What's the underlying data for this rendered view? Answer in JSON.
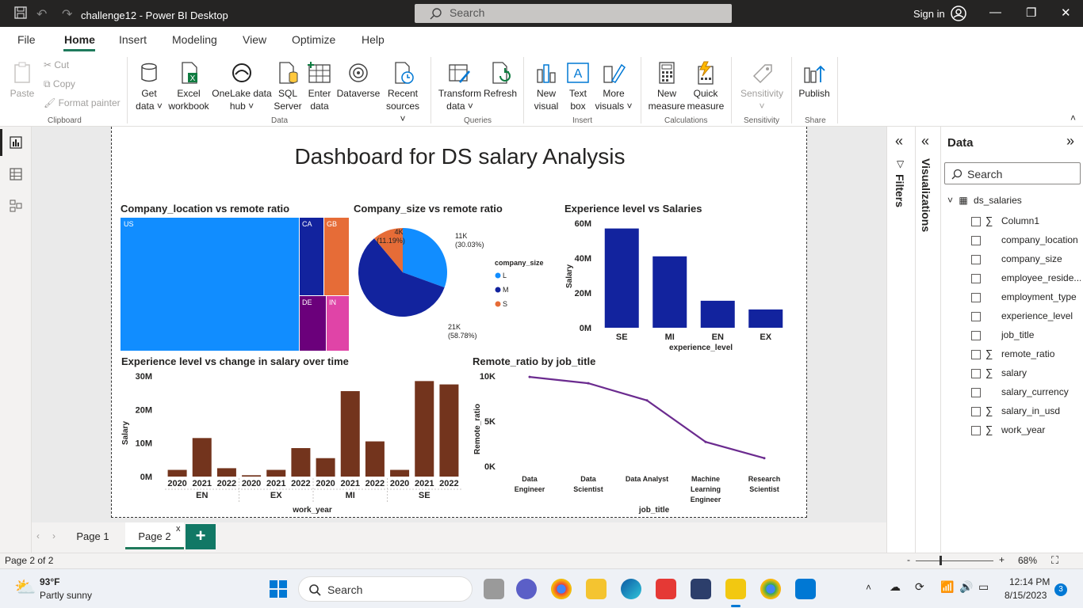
{
  "window": {
    "title": "challenge12 - Power BI Desktop",
    "search_placeholder": "Search",
    "signin": "Sign in"
  },
  "menu": {
    "file": "File",
    "home": "Home",
    "insert": "Insert",
    "modeling": "Modeling",
    "view": "View",
    "optimize": "Optimize",
    "help": "Help"
  },
  "ribbon": {
    "clipboard": {
      "paste": "Paste",
      "cut": "Cut",
      "copy": "Copy",
      "format_painter": "Format painter",
      "label": "Clipboard"
    },
    "data": {
      "get_data_1": "Get",
      "get_data_2": "data",
      "excel_1": "Excel",
      "excel_2": "workbook",
      "onelake_1": "OneLake data",
      "onelake_2": "hub",
      "sql_1": "SQL",
      "sql_2": "Server",
      "enter_1": "Enter",
      "enter_2": "data",
      "dataverse": "Dataverse",
      "recent_1": "Recent",
      "recent_2": "sources",
      "label": "Data"
    },
    "queries": {
      "transform_1": "Transform",
      "transform_2": "data",
      "refresh": "Refresh",
      "label": "Queries"
    },
    "insert": {
      "newvisual_1": "New",
      "newvisual_2": "visual",
      "textbox_1": "Text",
      "textbox_2": "box",
      "morevisuals_1": "More",
      "morevisuals_2": "visuals",
      "label": "Insert"
    },
    "calculations": {
      "newmeasure_1": "New",
      "newmeasure_2": "measure",
      "quick_1": "Quick",
      "quick_2": "measure",
      "label": "Calculations"
    },
    "sensitivity": {
      "btn": "Sensitivity",
      "label": "Sensitivity"
    },
    "share": {
      "publish": "Publish",
      "label": "Share"
    }
  },
  "report": {
    "title": "Dashboard for DS salary Analysis",
    "treemap_title": "Company_location vs remote ratio",
    "pie_title": "Company_size vs remote ratio",
    "bar1_title": "Experience level vs Salaries",
    "bar2_title": "Experience level vs change in salary over time",
    "line_title": "Remote_ratio by job_title"
  },
  "chart_data": [
    {
      "type": "treemap",
      "title": "Company_location vs remote ratio",
      "categories": [
        "US",
        "CA",
        "GB",
        "DE",
        "IN"
      ],
      "colors": [
        "#118dff",
        "#12239e",
        "#e66c37",
        "#6b007b",
        "#e044a7"
      ]
    },
    {
      "type": "pie",
      "title": "Company_size vs remote ratio",
      "legend_title": "company_size",
      "legend_position": "right",
      "slices": [
        {
          "name": "L",
          "value": 11000,
          "label": "11K",
          "pct": "(30.03%)",
          "color": "#118dff"
        },
        {
          "name": "M",
          "value": 21000,
          "label": "21K",
          "pct": "(58.78%)",
          "color": "#12239e"
        },
        {
          "name": "S",
          "value": 4000,
          "label": "4K",
          "pct": "(11.19%)",
          "color": "#e66c37"
        }
      ]
    },
    {
      "type": "bar",
      "title": "Experience level vs Salaries",
      "categories": [
        "SE",
        "MI",
        "EN",
        "EX"
      ],
      "values": [
        57000000,
        41000000,
        15500000,
        10500000
      ],
      "xlabel": "experience_level",
      "ylabel": "Salary",
      "ylim": [
        0,
        60000000
      ],
      "yticks": [
        "0M",
        "20M",
        "40M",
        "60M"
      ],
      "color": "#12239e"
    },
    {
      "type": "bar",
      "title": "Experience level vs change in salary over time",
      "groups": [
        "EN",
        "EX",
        "MI",
        "SE"
      ],
      "years": [
        "2020",
        "2021",
        "2022"
      ],
      "values": [
        2000000,
        11500000,
        2500000,
        400000,
        2000000,
        8500000,
        5500000,
        25500000,
        10500000,
        2000000,
        28500000,
        27500000
      ],
      "xlabel": "work_year",
      "ylabel": "Salary",
      "ylim": [
        0,
        30000000
      ],
      "yticks": [
        "0M",
        "10M",
        "20M",
        "30M"
      ],
      "color": "#73341d"
    },
    {
      "type": "line",
      "title": "Remote_ratio by job_title",
      "categories": [
        "Data Engineer",
        "Data Scientist",
        "Data Analyst",
        "Machine Learning Engineer",
        "Research Scientist"
      ],
      "cat_lines": [
        [
          "Data",
          "Engineer"
        ],
        [
          "Data",
          "Scientist"
        ],
        [
          "Data Analyst"
        ],
        [
          "Machine",
          "Learning",
          "Engineer"
        ],
        [
          "Research",
          "Scientist"
        ]
      ],
      "values": [
        9900,
        9200,
        7300,
        2700,
        900
      ],
      "xlabel": "job_title",
      "ylabel": "Remote_ratio",
      "ylim": [
        0,
        10000
      ],
      "yticks": [
        "0K",
        "5K",
        "10K"
      ],
      "color": "#6b2b8f"
    }
  ],
  "panes": {
    "filters": "Filters",
    "visualizations": "Visualizations",
    "data": "Data",
    "search": "Search",
    "table": "ds_salaries"
  },
  "fields": [
    {
      "name": "Column1",
      "sigma": true
    },
    {
      "name": "company_location",
      "sigma": false
    },
    {
      "name": "company_size",
      "sigma": false
    },
    {
      "name": "employee_reside...",
      "sigma": false
    },
    {
      "name": "employment_type",
      "sigma": false
    },
    {
      "name": "experience_level",
      "sigma": false
    },
    {
      "name": "job_title",
      "sigma": false
    },
    {
      "name": "remote_ratio",
      "sigma": true
    },
    {
      "name": "salary",
      "sigma": true
    },
    {
      "name": "salary_currency",
      "sigma": false
    },
    {
      "name": "salary_in_usd",
      "sigma": true
    },
    {
      "name": "work_year",
      "sigma": true
    }
  ],
  "pages": {
    "page1": "Page 1",
    "page2": "Page 2",
    "close": "x",
    "add": "+"
  },
  "status": {
    "page_info": "Page 2 of 2",
    "zoom": "68%",
    "minus": "-",
    "plus": "+"
  },
  "taskbar": {
    "temp": "93°F",
    "weather": "Partly sunny",
    "search": "Search",
    "time": "12:14 PM",
    "date": "8/15/2023",
    "badge": "3"
  }
}
